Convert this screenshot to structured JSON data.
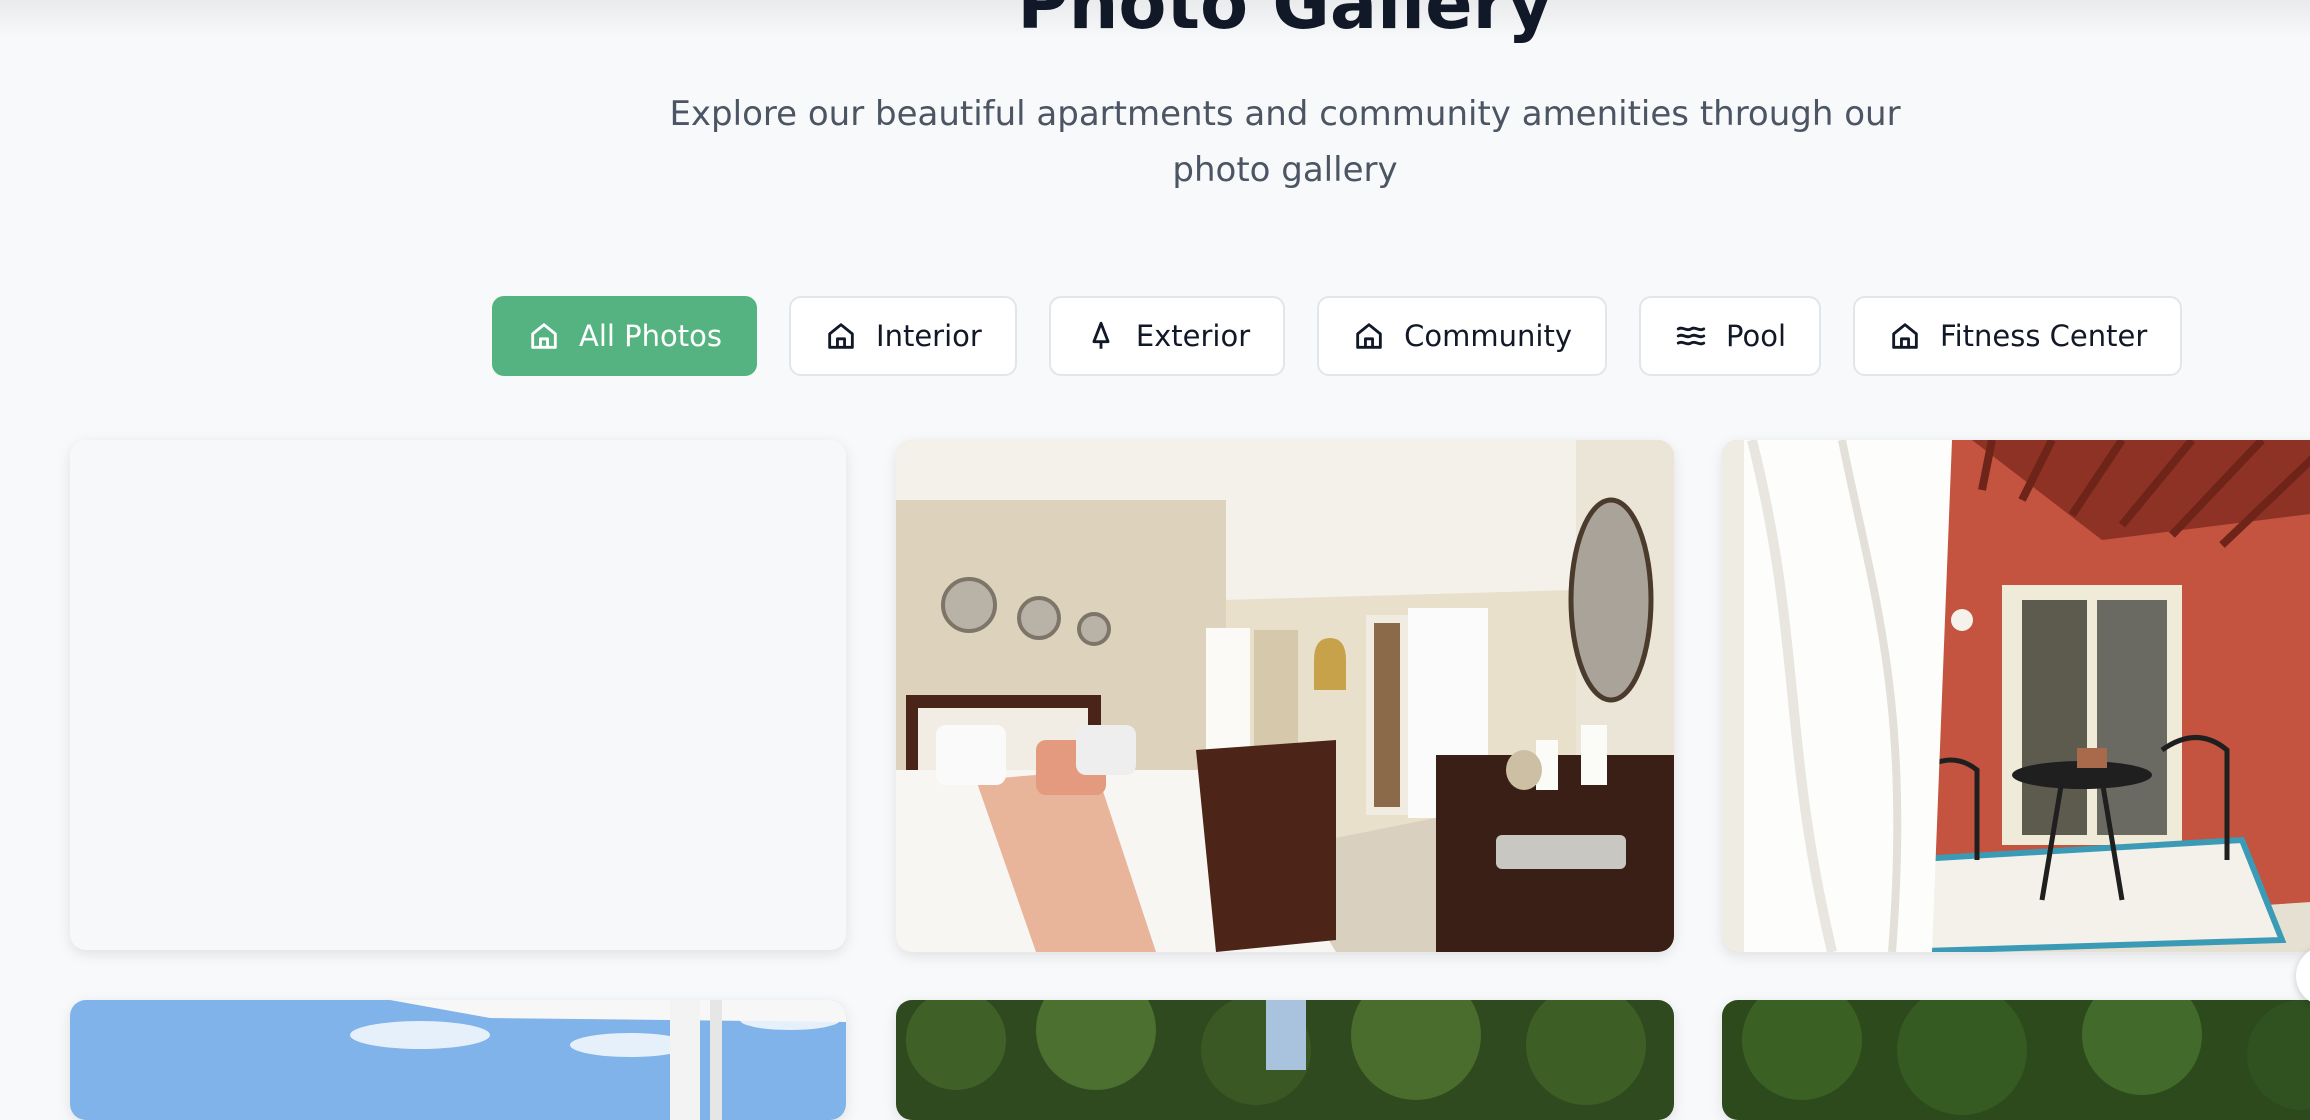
{
  "page": {
    "title": "Photo Gallery",
    "subtitle": "Explore our beautiful apartments and community amenities through our photo gallery"
  },
  "filters": [
    {
      "label": "All Photos",
      "icon": "home-icon",
      "active": true
    },
    {
      "label": "Interior",
      "icon": "home-icon",
      "active": false
    },
    {
      "label": "Exterior",
      "icon": "tree-icon",
      "active": false
    },
    {
      "label": "Community",
      "icon": "home-icon",
      "active": false
    },
    {
      "label": "Pool",
      "icon": "waves-icon",
      "active": false
    },
    {
      "label": "Fitness Center",
      "icon": "home-icon",
      "active": false
    }
  ],
  "colors": {
    "accent": "#55b382",
    "title": "#111827",
    "subtitle": "#4b5563",
    "background": "#f8f9fb"
  },
  "gallery": [
    {
      "content": "loading-placeholder"
    },
    {
      "content": "bedroom-photo"
    },
    {
      "content": "patio-photo"
    },
    {
      "content": "pergola-sky-photo"
    },
    {
      "content": "trees-photo"
    },
    {
      "content": "trees-photo"
    }
  ]
}
